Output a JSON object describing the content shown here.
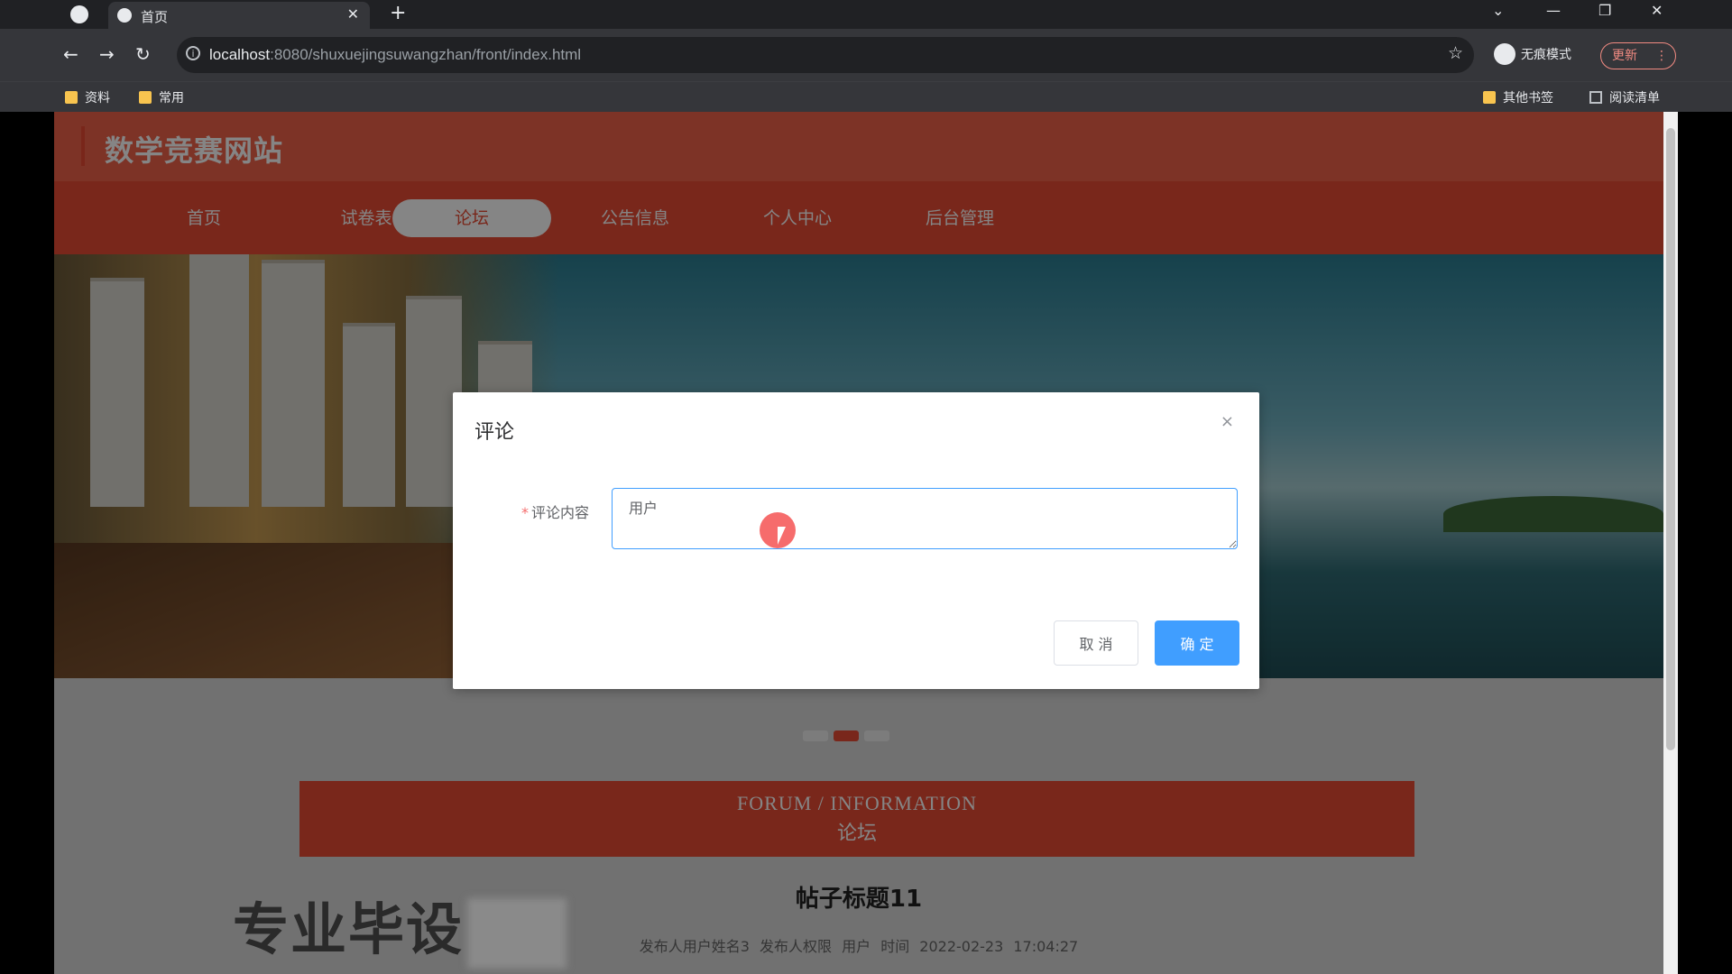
{
  "browser": {
    "tab_title": "首页",
    "tab_close": "✕",
    "new_tab": "+",
    "url_host": "localhost",
    "url_rest": ":8080/shuxuejingsuwangzhan/front/index.html",
    "incognito_label": "无痕模式",
    "update_label": "更新",
    "bookmarks": [
      "资料",
      "常用"
    ],
    "other_bookmarks": "其他书签",
    "reading_list": "阅读清单"
  },
  "site": {
    "title": "数学竞赛网站",
    "nav": [
      {
        "label": "首页",
        "active": false
      },
      {
        "label": "试卷表",
        "active": false
      },
      {
        "label": "论坛",
        "active": true
      },
      {
        "label": "公告信息",
        "active": false
      },
      {
        "label": "个人中心",
        "active": false
      },
      {
        "label": "后台管理",
        "active": false
      }
    ],
    "accent_color": "#e94c35"
  },
  "forum": {
    "heading_en": "FORUM / INFORMATION",
    "heading_cn": "论坛",
    "post_title": "帖子标题11",
    "post_meta": "发布人用户姓名3  发布人权限  用户  时间  2022-02-23 17:04:27"
  },
  "watermark": {
    "text": "专业毕设"
  },
  "dialog": {
    "title": "评论",
    "close": "×",
    "required_mark": "*",
    "field_label": "评论内容",
    "field_value": "用户",
    "cancel_label": "取 消",
    "ok_label": "确 定",
    "primary_color": "#409eff"
  }
}
